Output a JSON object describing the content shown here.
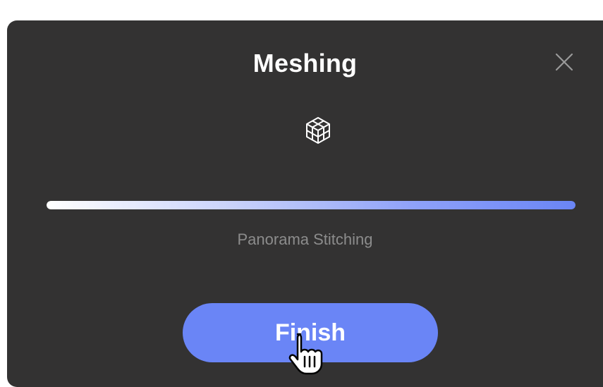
{
  "dialog": {
    "title": "Meshing",
    "close_icon": "close-icon",
    "center_icon": "mesh-cube-icon",
    "progress": {
      "value": 1.0,
      "colors": [
        "#ffffff",
        "#6a85f6"
      ]
    },
    "status_text": "Panorama Stitching",
    "finish_label": "Finish"
  },
  "cursor": "hand-pointer-cursor",
  "colors": {
    "dialog_bg": "#333232",
    "accent": "#6a85f6",
    "status_text": "#8c8c8c"
  }
}
